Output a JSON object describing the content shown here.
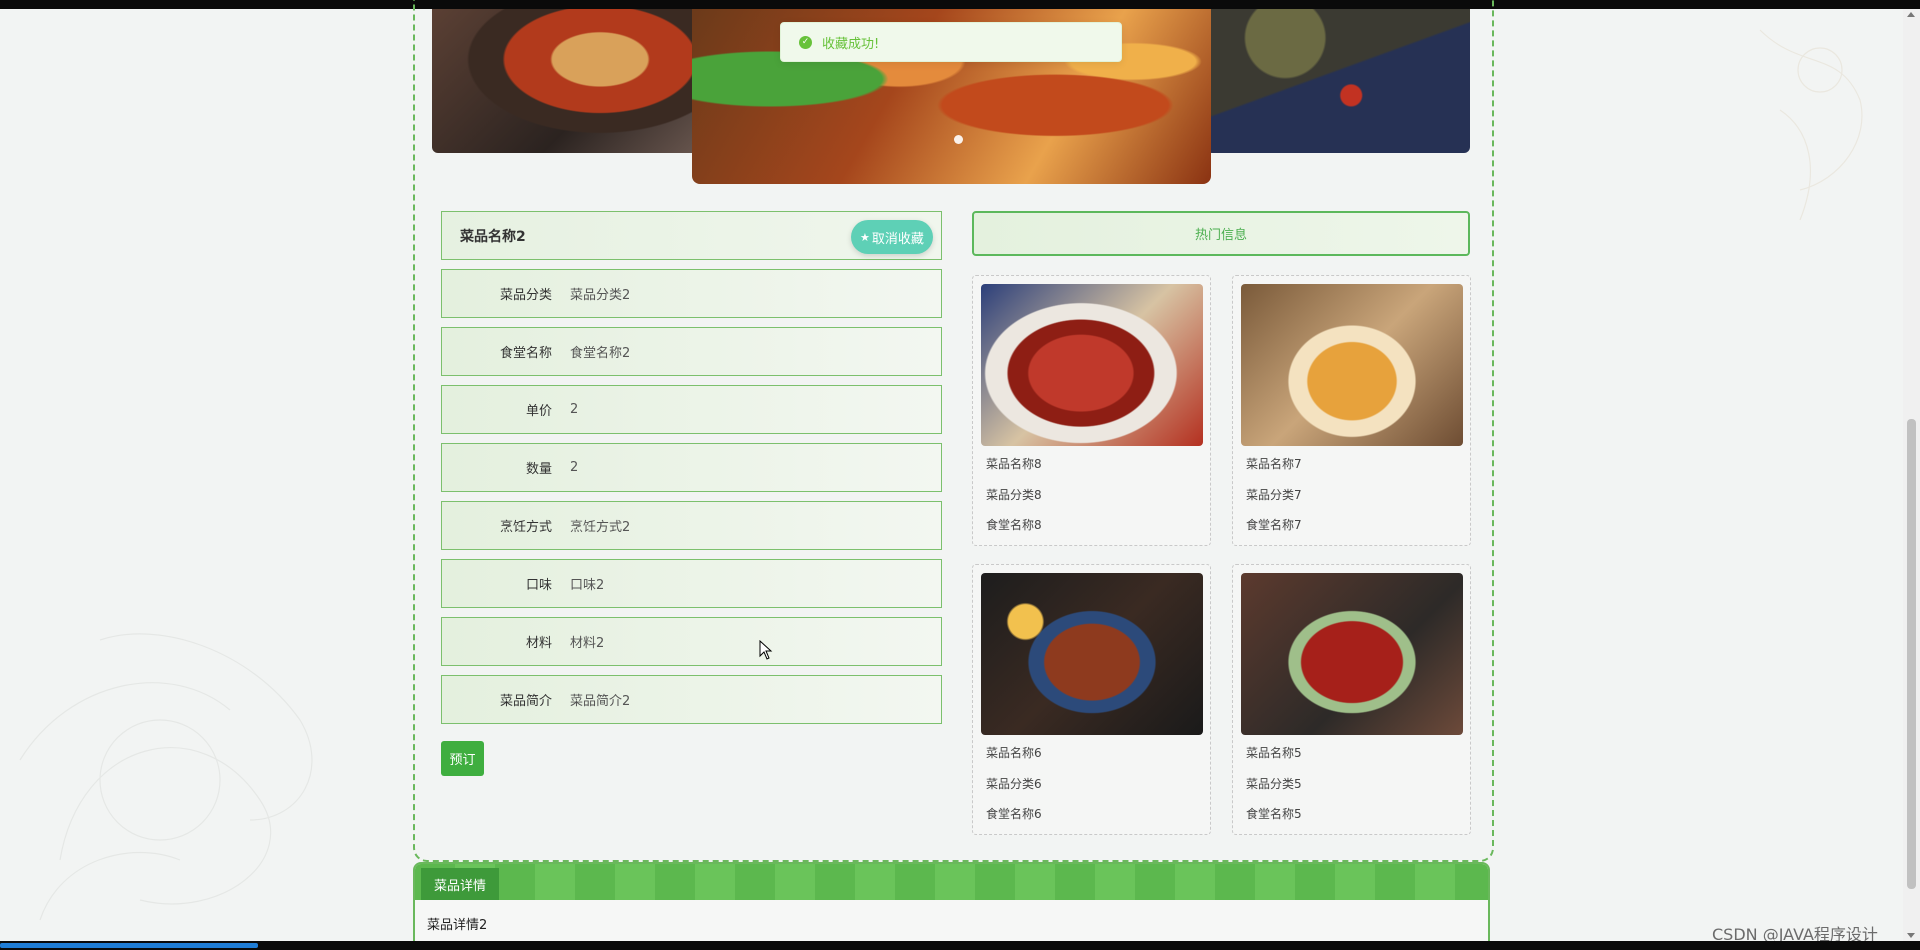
{
  "toast": {
    "message": "收藏成功!"
  },
  "dish": {
    "name": "菜品名称2",
    "cancel_fav_label": "取消收藏",
    "fields": [
      {
        "label": "菜品分类",
        "value": "菜品分类2"
      },
      {
        "label": "食堂名称",
        "value": "食堂名称2"
      },
      {
        "label": "单价",
        "value": "2"
      },
      {
        "label": "数量",
        "value": "2"
      },
      {
        "label": "烹饪方式",
        "value": "烹饪方式2"
      },
      {
        "label": "口味",
        "value": "口味2"
      },
      {
        "label": "材料",
        "value": "材料2"
      },
      {
        "label": "菜品简介",
        "value": "菜品简介2"
      }
    ],
    "book_label": "预订"
  },
  "hot": {
    "title": "热门信息",
    "cards": [
      {
        "name": "菜品名称8",
        "category": "菜品分类8",
        "canteen": "食堂名称8"
      },
      {
        "name": "菜品名称7",
        "category": "菜品分类7",
        "canteen": "食堂名称7"
      },
      {
        "name": "菜品名称6",
        "category": "菜品分类6",
        "canteen": "食堂名称6"
      },
      {
        "name": "菜品名称5",
        "category": "菜品分类5",
        "canteen": "食堂名称5"
      }
    ]
  },
  "detail": {
    "tab_label": "菜品详情",
    "content": "菜品详情2"
  },
  "watermark": "CSDN @JAVA程序设计",
  "colors": {
    "accent": "#5cb85c",
    "success": "#67c23a",
    "cancel_button": "#5ed0b6"
  }
}
